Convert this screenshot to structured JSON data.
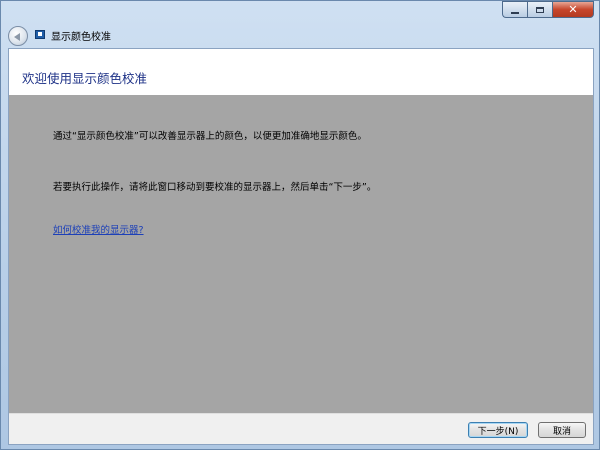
{
  "window": {
    "title": "显示颜色校准",
    "controls": {
      "close": "✕"
    }
  },
  "page": {
    "heading": "欢迎使用显示颜色校准",
    "paragraph1": "通过“显示颜色校准”可以改善显示器上的颜色，以便更加准确地显示颜色。",
    "paragraph2": "若要执行此操作，请将此窗口移动到要校准的显示器上，然后单击“下一步”。",
    "help_link": "如何校准我的显示器?"
  },
  "footer": {
    "next_label": "下一步(N)",
    "cancel_label": "取消"
  },
  "colors": {
    "main_background": "#a5a5a5",
    "heading": "#1e3287",
    "link": "#1d40b8",
    "close_button": "#c7462c"
  }
}
